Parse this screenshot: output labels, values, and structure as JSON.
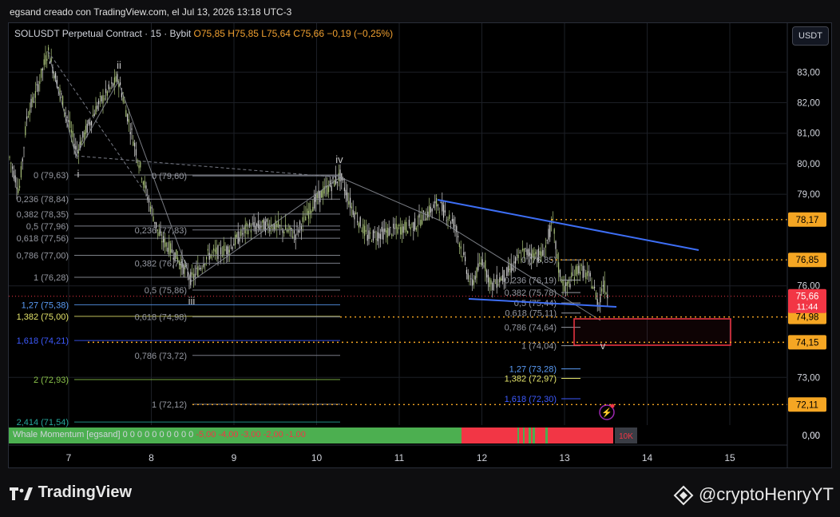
{
  "header": {
    "credit": "egsand creado con TradingView.com, el Jul 13, 2026 13:18 UTC-3"
  },
  "legend": {
    "symbol": "SOLUSDT Perpetual Contract · 15 · Bybit",
    "ohlc": "O75,85  H75,85  L75,64  C75,66  −0,19 (−0,25%)"
  },
  "currency_button": "USDT",
  "price_axis": {
    "ticks": [
      {
        "label": "83,00",
        "price": 83.0
      },
      {
        "label": "82,00",
        "price": 82.0
      },
      {
        "label": "81,00",
        "price": 81.0
      },
      {
        "label": "80,00",
        "price": 80.0
      },
      {
        "label": "79,00",
        "price": 79.0
      },
      {
        "label": "76,00",
        "price": 76.0
      },
      {
        "label": "73,00",
        "price": 73.0
      },
      {
        "label": "0,00",
        "price": null
      }
    ],
    "badges": [
      {
        "label": "78,17",
        "price": 78.17,
        "color": "#f5a623"
      },
      {
        "label": "76,85",
        "price": 76.85,
        "color": "#f5a623"
      },
      {
        "label": "74,98",
        "price": 74.98,
        "color": "#f5a623"
      },
      {
        "label": "74,15",
        "price": 74.15,
        "color": "#f5a623"
      },
      {
        "label": "72,11",
        "price": 72.11,
        "color": "#f5a623"
      }
    ],
    "last_price": {
      "label": "75,66",
      "countdown": "11:44",
      "price": 75.66,
      "color": "#f23645"
    }
  },
  "time_axis": {
    "labels": [
      "7",
      "8",
      "9",
      "10",
      "11",
      "12",
      "13",
      "14",
      "15"
    ]
  },
  "fib_left": [
    {
      "label": "0 (79,63)",
      "price": 79.63,
      "color": "#9598a1"
    },
    {
      "label": "0,236 (78,84)",
      "price": 78.84,
      "color": "#9598a1"
    },
    {
      "label": "0,382 (78,35)",
      "price": 78.35,
      "color": "#9598a1"
    },
    {
      "label": "0,5 (77,96)",
      "price": 77.96,
      "color": "#9598a1"
    },
    {
      "label": "0,618 (77,56)",
      "price": 77.56,
      "color": "#9598a1"
    },
    {
      "label": "0,786 (77,00)",
      "price": 77.0,
      "color": "#9598a1"
    },
    {
      "label": "1 (76,28)",
      "price": 76.28,
      "color": "#9598a1"
    },
    {
      "label": "1,27 (75,38)",
      "price": 75.38,
      "color": "#5b9cf6"
    },
    {
      "label": "1,382 (75,00)",
      "price": 75.0,
      "color": "#e3e36a"
    },
    {
      "label": "1,618 (74,21)",
      "price": 74.21,
      "color": "#3d5afe"
    },
    {
      "label": "2 (72,93)",
      "price": 72.93,
      "color": "#8bc34a"
    },
    {
      "label": "2,414 (71,54)",
      "price": 71.54,
      "color": "#26a69a"
    }
  ],
  "fib_mid": [
    {
      "label": "0 (79,60)",
      "price": 79.6
    },
    {
      "label": "0,236 (77,83)",
      "price": 77.83
    },
    {
      "label": "0,382 (76,74)",
      "price": 76.74
    },
    {
      "label": "0,5 (75,86)",
      "price": 75.86
    },
    {
      "label": "0,618 (74,98)",
      "price": 74.98
    },
    {
      "label": "0,786 (73,72)",
      "price": 73.72
    },
    {
      "label": "1 (72,12)",
      "price": 72.12
    }
  ],
  "fib_right": [
    {
      "label": "0 (76,85)",
      "price": 76.85,
      "color": "#9598a1"
    },
    {
      "label": "0,236 (76,19)",
      "price": 76.19,
      "color": "#9598a1"
    },
    {
      "label": "0,382 (75,78)",
      "price": 75.78,
      "color": "#9598a1"
    },
    {
      "label": "0,5 (75,44)",
      "price": 75.44,
      "color": "#9598a1"
    },
    {
      "label": "0,618 (75,11)",
      "price": 75.11,
      "color": "#9598a1"
    },
    {
      "label": "0,786 (74,64)",
      "price": 74.64,
      "color": "#9598a1"
    },
    {
      "label": "1 (74,04)",
      "price": 74.04,
      "color": "#9598a1"
    },
    {
      "label": "1,27 (73,28)",
      "price": 73.28,
      "color": "#5b9cf6"
    },
    {
      "label": "1,382 (72,97)",
      "price": 72.97,
      "color": "#e3e36a"
    },
    {
      "label": "1,618 (72,30)",
      "price": 72.3,
      "color": "#3d5afe"
    }
  ],
  "waves": [
    "i",
    "ii",
    "iii",
    "iv",
    "v"
  ],
  "indicator": {
    "name": "Whale Momentum [egsand]",
    "zeros": "0 0 0 0 0 0 0 0 0 0",
    "neg_values": "-5,00 -4,00 -3,00 -2,00 -1,00",
    "axis_value": "0,00",
    "right_tag": "10K"
  },
  "footer": {
    "brand": "TradingView",
    "handle": "@cryptoHenryYT"
  },
  "colors": {
    "up": "#a9c27a",
    "down": "#d6d6d6",
    "trend": "#3d6ef5",
    "target_box": "#f23645",
    "orange": "#f5a623",
    "grid": "#1c1f26"
  }
}
